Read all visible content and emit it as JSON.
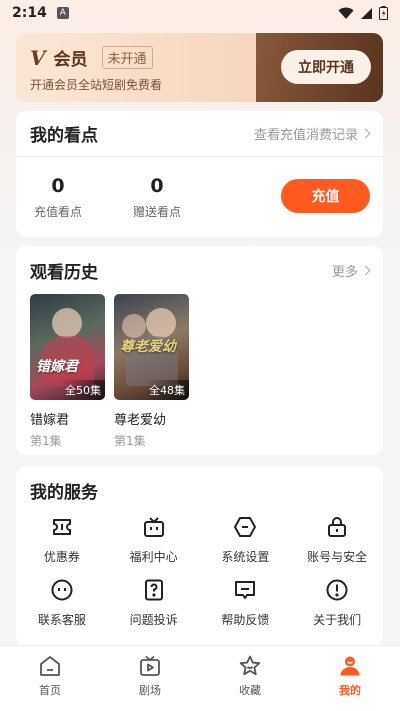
{
  "status_bar": {
    "time": "2:14",
    "notification_letter": "A"
  },
  "vip": {
    "logo_mark": "V",
    "title": "会员",
    "status": "未开通",
    "subtitle": "开通会员全站短剧免费看",
    "button": "立即开通"
  },
  "points": {
    "title": "我的看点",
    "link": "查看充值消费记录",
    "recharged": {
      "value": "0",
      "label": "充值看点"
    },
    "gifted": {
      "value": "0",
      "label": "赠送看点"
    },
    "button": "充值"
  },
  "history": {
    "title": "观看历史",
    "more": "更多",
    "items": [
      {
        "title": "错嫁君",
        "episode": "第1集",
        "total": "全50集",
        "poster_text": "错嫁君"
      },
      {
        "title": "尊老爱幼",
        "episode": "第1集",
        "total": "全48集",
        "poster_text": "尊老爱幼"
      }
    ]
  },
  "services": {
    "title": "我的服务",
    "items": [
      {
        "label": "优惠券",
        "icon": "ticket-icon"
      },
      {
        "label": "福利中心",
        "icon": "tv-gift-icon"
      },
      {
        "label": "系统设置",
        "icon": "settings-hexagon-icon"
      },
      {
        "label": "账号与安全",
        "icon": "lock-icon"
      },
      {
        "label": "联系客服",
        "icon": "smiley-icon"
      },
      {
        "label": "问题投诉",
        "icon": "question-doc-icon"
      },
      {
        "label": "帮助反馈",
        "icon": "feedback-icon"
      },
      {
        "label": "关于我们",
        "icon": "info-icon"
      }
    ]
  },
  "nav": {
    "items": [
      {
        "label": "首页",
        "icon": "home-icon"
      },
      {
        "label": "剧场",
        "icon": "theater-icon"
      },
      {
        "label": "收藏",
        "icon": "star-icon"
      },
      {
        "label": "我的",
        "icon": "profile-icon",
        "active": true
      }
    ],
    "active_color": "#ff5a1f"
  }
}
